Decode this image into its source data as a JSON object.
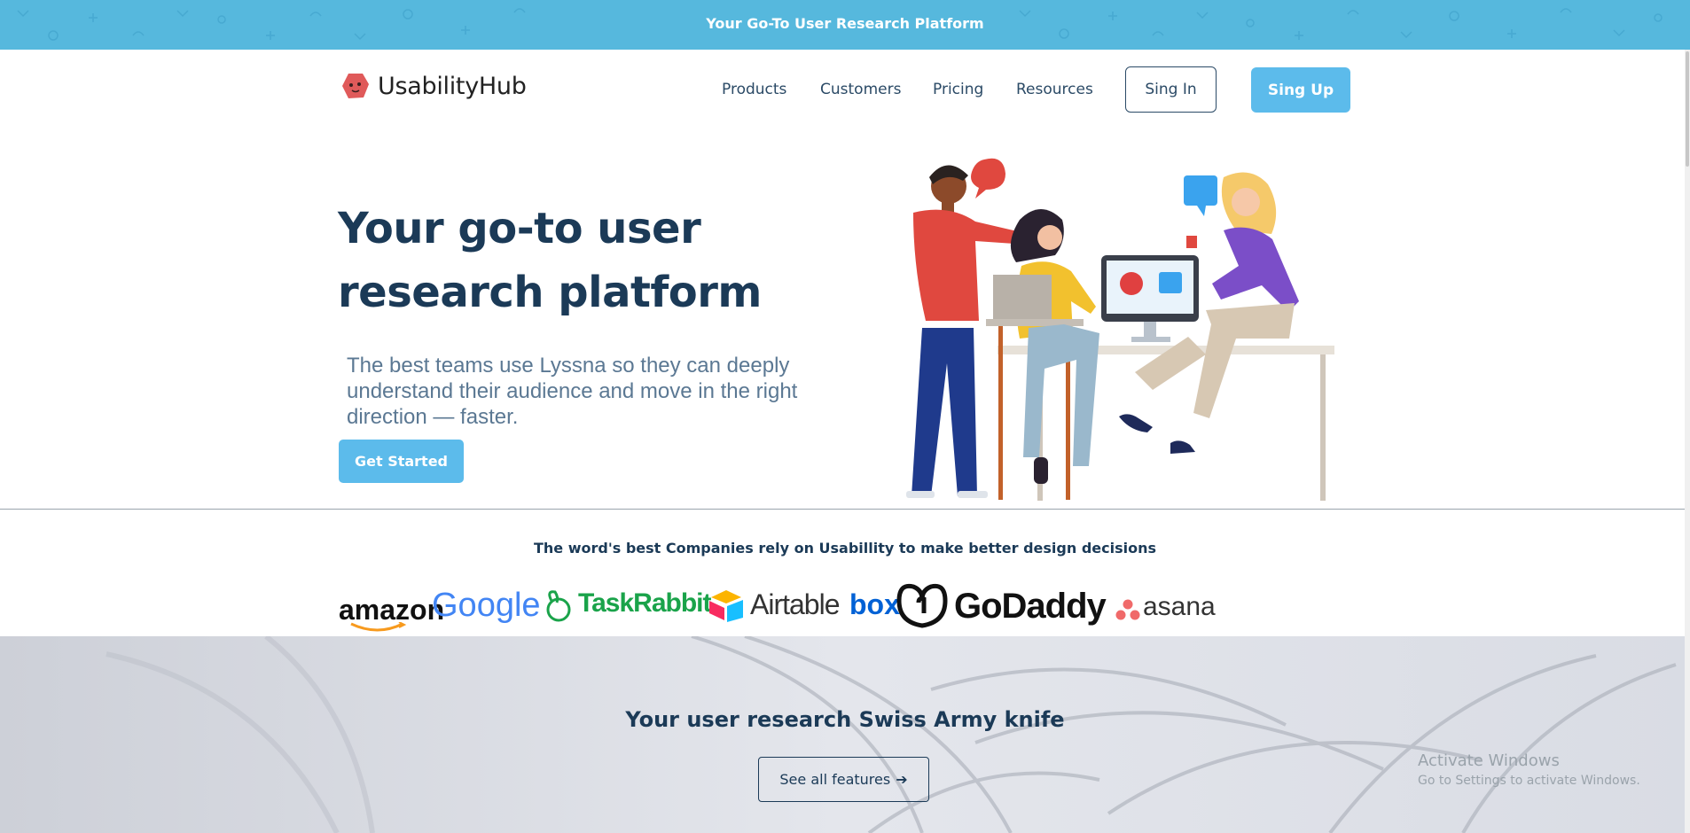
{
  "banner": {
    "text": "Your Go-To User Research Platform"
  },
  "header": {
    "logo_text": "UsabilityHub",
    "nav": [
      "Products",
      "Customers",
      "Pricing",
      "Resources"
    ],
    "signin_label": "Sing In",
    "signup_label": "Sing Up"
  },
  "hero": {
    "title_line1": "Your go-to user",
    "title_line2": "research platform",
    "subtitle": "The best teams use Lyssna so they can deeply understand their audience and move in the right direction — faster.",
    "cta_label": "Get Started"
  },
  "companies": {
    "text": "The word's best Companies rely on Usabillity to make better design decisions",
    "logos": [
      "amazon",
      "Google",
      "TaskRabbit",
      "Airtable",
      "box",
      "GoDaddy",
      "asana"
    ]
  },
  "features": {
    "title": "Your user research Swiss Army knife",
    "button_label": "See all features",
    "button_icon": "arrow-right-icon"
  },
  "watermark": {
    "line1": "Activate Windows",
    "line2": "Go to Settings to activate Windows."
  },
  "colors": {
    "banner": "#56b8dd",
    "primary_button": "#5cbbeb",
    "navy": "#1b3a57",
    "text_muted": "#5b7893"
  }
}
